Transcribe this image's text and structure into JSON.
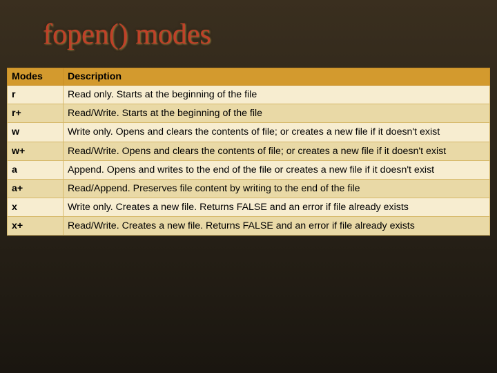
{
  "title": "fopen() modes",
  "headers": {
    "col0": "Modes",
    "col1": "Description"
  },
  "rows": {
    "0": {
      "mode": "r",
      "desc": "Read only. Starts at the beginning of the file"
    },
    "1": {
      "mode": "r+",
      "desc": "Read/Write. Starts at the beginning of the file"
    },
    "2": {
      "mode": "w",
      "desc": "Write only. Opens and clears the contents of file; or creates a new file if it doesn't exist"
    },
    "3": {
      "mode": "w+",
      "desc": "Read/Write. Opens and clears the contents of file; or creates a new file if it doesn't exist"
    },
    "4": {
      "mode": "a",
      "desc": "Append. Opens and writes to the end of the file or creates a new file if it doesn't exist"
    },
    "5": {
      "mode": "a+",
      "desc": "Read/Append. Preserves file content by writing to the end of the file"
    },
    "6": {
      "mode": "x",
      "desc": "Write only. Creates a new file. Returns FALSE and an error if file already exists"
    },
    "7": {
      "mode": "x+",
      "desc": "Read/Write. Creates a new file. Returns FALSE and an error if file already exists"
    }
  }
}
